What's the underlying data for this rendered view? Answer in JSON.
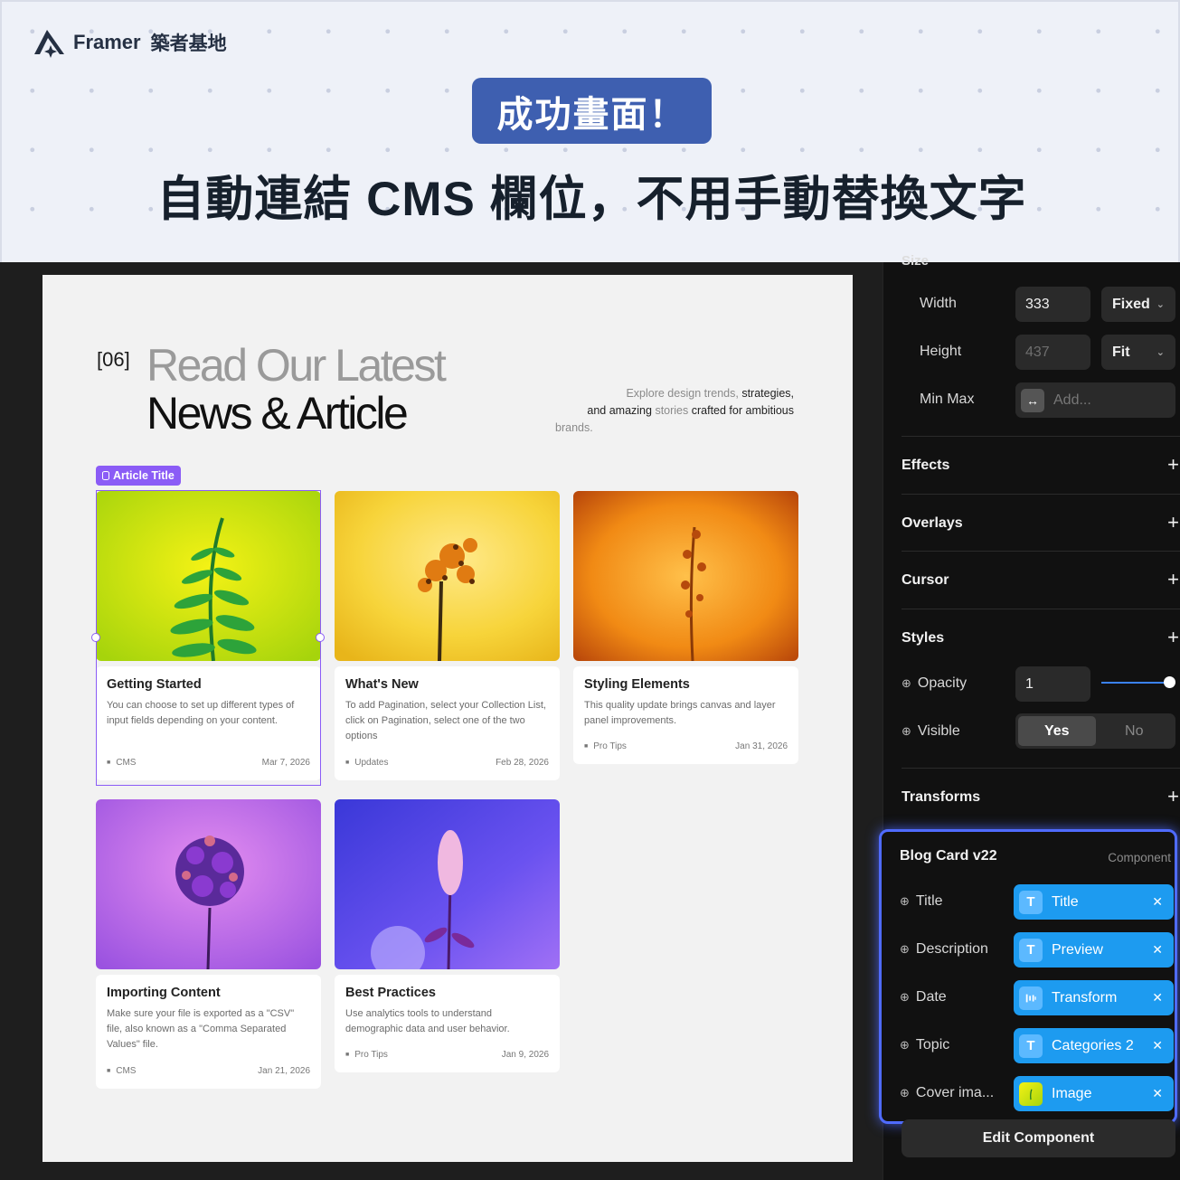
{
  "banner": {
    "brand_name": "Framer",
    "brand_cn": "築者基地",
    "badge": "成功畫面！",
    "headline": "自動連結 CMS 欄位，不用手動替換文字"
  },
  "page": {
    "index": "[06]",
    "heading_light": "Read Our Latest",
    "heading_dark": "News & Article",
    "intro_1": "Explore design trends,",
    "intro_2": "strategies,",
    "intro_3": "and amazing",
    "intro_4": "stories",
    "intro_5": "crafted for ambitious",
    "intro_6": "brands.",
    "selection_tag": "Article Title"
  },
  "cards": [
    {
      "title": "Getting Started",
      "desc": "You can choose to set up different types of input fields depending on your content.",
      "topic": "CMS",
      "date": "Mar 7, 2026"
    },
    {
      "title": "What's New",
      "desc": "To add Pagination, select your Collection List, click on Pagination, select one of the two options",
      "topic": "Updates",
      "date": "Feb 28, 2026"
    },
    {
      "title": "Styling Elements",
      "desc": "This quality update brings canvas and layer panel improvements.",
      "topic": "Pro Tips",
      "date": "Jan 31, 2026"
    },
    {
      "title": "Importing Content",
      "desc": "Make sure your file is exported as a \"CSV\" file, also known as a \"Comma Separated Values\" file.",
      "topic": "CMS",
      "date": "Jan 21, 2026"
    },
    {
      "title": "Best Practices",
      "desc": "Use analytics tools to understand demographic data and user behavior.",
      "topic": "Pro Tips",
      "date": "Jan 9, 2026"
    }
  ],
  "panel": {
    "size": {
      "width_label": "Width",
      "width_value": "333",
      "width_mode": "Fixed",
      "height_label": "Height",
      "height_value": "437",
      "height_mode": "Fit",
      "minmax_label": "Min Max",
      "minmax_placeholder": "Add..."
    },
    "sections": {
      "effects": "Effects",
      "overlays": "Overlays",
      "cursor": "Cursor",
      "styles": "Styles",
      "transforms": "Transforms"
    },
    "styles": {
      "opacity_label": "Opacity",
      "opacity_value": "1",
      "opacity_level": 1.0,
      "visible_label": "Visible",
      "visible_yes": "Yes",
      "visible_no": "No"
    },
    "component": {
      "name": "Blog Card v22",
      "kind": "Component",
      "props": [
        {
          "label": "Title",
          "value": "Title",
          "icon": "T"
        },
        {
          "label": "Description",
          "value": "Preview",
          "icon": "T"
        },
        {
          "label": "Date",
          "value": "Transform",
          "icon": "date-icon"
        },
        {
          "label": "Topic",
          "value": "Categories 2",
          "icon": "T"
        },
        {
          "label": "Cover ima...",
          "value": "Image",
          "icon": "image-thumb"
        }
      ],
      "edit_button": "Edit Component"
    }
  },
  "colors": {
    "accent_blue": "#1d9bf0",
    "selection_purple": "#8b5cf6",
    "badge_blue": "#3e5fb0"
  }
}
